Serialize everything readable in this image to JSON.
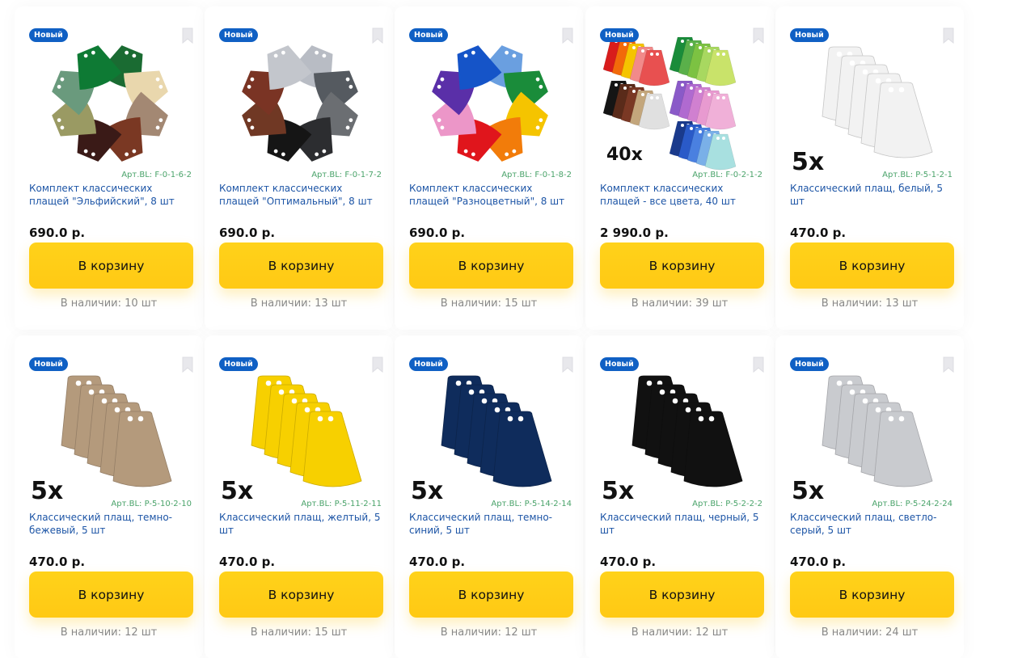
{
  "cart_label": "В корзину",
  "new_badge": "Новый",
  "products": [
    {
      "badge": "Новый",
      "image": "cape-wheel-elf",
      "art": "Арт.BL: F-0-1-6-2",
      "title": "Комплект классических плащей \"Эльфийский\", 8 шт",
      "price": "690.0 р.",
      "stock": "В наличии: 10 шт",
      "colors": [
        "#1a6b32",
        "#e9d7ad",
        "#a38873",
        "#7a3823",
        "#3a1a17",
        "#9a9a63",
        "#6a9a7d",
        "#0e7a34"
      ]
    },
    {
      "badge": "Новый",
      "image": "cape-wheel-optimal",
      "art": "Арт.BL: F-0-1-7-2",
      "title": "Комплект классических плащей \"Оптимальный\", 8 шт",
      "price": "690.0 р.",
      "stock": "В наличии: 13 шт",
      "colors": [
        "#b8bcc4",
        "#555a60",
        "#6b6e72",
        "#2c2d30",
        "#151515",
        "#703824",
        "#7a3424",
        "#c3c6cc"
      ]
    },
    {
      "badge": "Новый",
      "image": "cape-wheel-multicolor",
      "art": "Арт.BL: F-0-1-8-2",
      "title": "Комплект классических плащей \"Разноцветный\", 8 шт",
      "price": "690.0 р.",
      "stock": "В наличии: 15 шт",
      "colors": [
        "#6a9fe0",
        "#1a8c3a",
        "#f5c400",
        "#f27c0a",
        "#e0151c",
        "#ec96c8",
        "#5a2fa8",
        "#1554c8"
      ]
    },
    {
      "badge": "Новый",
      "image": "cape-set-all-colors",
      "art": "Арт.BL: F-0-2-1-2",
      "title": "Комплект классических плащей - все цвета, 40 шт",
      "price": "2 990.0 р.",
      "stock": "В наличии: 39 шт",
      "multiplier": "40x"
    },
    {
      "badge": "Новый",
      "image": "cape-stack",
      "art": "Арт.BL: P-5-1-2-1",
      "title": "Классический плащ, белый, 5 шт",
      "price": "470.0 р.",
      "stock": "В наличии: 13 шт",
      "color": "#f2f2f2",
      "multiplier": "5x"
    },
    {
      "badge": "Новый",
      "image": "cape-stack",
      "art": "Арт.BL: P-5-10-2-10",
      "title": "Классический плащ, темно-бежевый, 5 шт",
      "price": "470.0 р.",
      "stock": "В наличии: 12 шт",
      "color": "#b49a7c",
      "multiplier": "5x"
    },
    {
      "badge": "Новый",
      "image": "cape-stack",
      "art": "Арт.BL: P-5-11-2-11",
      "title": "Классический плащ, желтый, 5 шт",
      "price": "470.0 р.",
      "stock": "В наличии: 15 шт",
      "color": "#f7d000",
      "multiplier": "5x"
    },
    {
      "badge": "Новый",
      "image": "cape-stack",
      "art": "Арт.BL: P-5-14-2-14",
      "title": "Классический плащ, темно-синий, 5 шт",
      "price": "470.0 р.",
      "stock": "В наличии: 12 шт",
      "color": "#0f2c5c",
      "multiplier": "5x"
    },
    {
      "badge": "Новый",
      "image": "cape-stack",
      "art": "Арт.BL: P-5-2-2-2",
      "title": "Классический плащ, черный, 5 шт",
      "price": "470.0 р.",
      "stock": "В наличии: 12 шт",
      "color": "#111111",
      "multiplier": "5x"
    },
    {
      "badge": "Новый",
      "image": "cape-stack",
      "art": "Арт.BL: P-5-24-2-24",
      "title": "Классический плащ, светло-серый, 5 шт",
      "price": "470.0 р.",
      "stock": "В наличии: 24 шт",
      "color": "#c9cbcf",
      "multiplier": "5x"
    }
  ],
  "palette": {
    "accent": "#ffd21a",
    "badge": "#1060c4",
    "title_link": "#1d55a6",
    "article": "#4aa36a",
    "stock": "#888888",
    "multiplier_text": "#111111"
  },
  "all_colors_swatches": [
    "#d81c1c",
    "#f26a0a",
    "#f5c400",
    "#e0e0e0",
    "#5a2b1a",
    "#7a3824",
    "#c3a67c",
    "#b0b3b8",
    "#1a8c3a",
    "#7cc242",
    "#c9e36a",
    "#f0a0c8",
    "#9a5ac8",
    "#2a5ac8",
    "#6aa0e0",
    "#9ad8d8",
    "#444",
    "#151515",
    "#e8dcb8",
    "#8a7a60"
  ]
}
